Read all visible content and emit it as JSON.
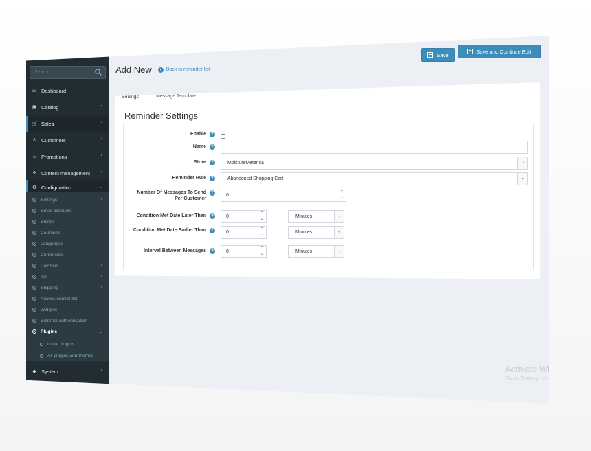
{
  "sidebar": {
    "search_placeholder": "Search",
    "items": [
      {
        "label": "Dashboard",
        "icon": "monitor-icon",
        "has_chevron": false
      },
      {
        "label": "Catalog",
        "icon": "book-icon",
        "has_chevron": true
      },
      {
        "label": "Sales",
        "icon": "cart-icon",
        "has_chevron": true
      },
      {
        "label": "Customers",
        "icon": "user-icon",
        "has_chevron": true
      },
      {
        "label": "Promotions",
        "icon": "tag-icon",
        "has_chevron": true
      },
      {
        "label": "Content management",
        "icon": "sitemap-icon",
        "has_chevron": true
      },
      {
        "label": "Configuration",
        "icon": "gears-icon",
        "has_chevron": true
      }
    ],
    "submenu": [
      {
        "label": "Settings",
        "has_chevron": true
      },
      {
        "label": "Email accounts",
        "has_chevron": false
      },
      {
        "label": "Stores",
        "has_chevron": false
      },
      {
        "label": "Countries",
        "has_chevron": false
      },
      {
        "label": "Languages",
        "has_chevron": false
      },
      {
        "label": "Currencies",
        "has_chevron": false
      },
      {
        "label": "Payment",
        "has_chevron": true
      },
      {
        "label": "Tax",
        "has_chevron": true
      },
      {
        "label": "Shipping",
        "has_chevron": true
      },
      {
        "label": "Access control list",
        "has_chevron": false
      },
      {
        "label": "Widgets",
        "has_chevron": false
      },
      {
        "label": "External authentication",
        "has_chevron": false
      },
      {
        "label": "Plugins",
        "has_chevron": true
      },
      {
        "label": "Local plugins",
        "has_chevron": false
      },
      {
        "label": "All plugins and themes",
        "has_chevron": false
      }
    ],
    "system": {
      "label": "System",
      "icon": "cube-icon",
      "has_chevron": true
    }
  },
  "header": {
    "title": "Add New",
    "back_link": "Back to reminder list",
    "save_label": "Save",
    "save_continue_label": "Save and Continue Edit"
  },
  "tabs": [
    {
      "label": "Settings",
      "active": true
    },
    {
      "label": "Message Template",
      "active": false
    }
  ],
  "section_title": "Reminder Settings",
  "form": {
    "enable_label": "Enable",
    "name_label": "Name",
    "name_value": "",
    "store_label": "Store",
    "store_value": "MoistureMeter.ca",
    "rule_label": "Reminder Rule",
    "rule_value": "Abandoned Shopping Cart",
    "messages_label": "Number Of Messages To Send Per Customer",
    "messages_value": "0",
    "later_label": "Condition Met Date Later Than",
    "later_value": "0",
    "later_unit": "Minutes",
    "earlier_label": "Condition Met Date Earlier Than",
    "earlier_value": "0",
    "earlier_unit": "Minutes",
    "interval_label": "Interval Between Messages",
    "interval_value": "0",
    "interval_unit": "Minutes"
  },
  "watermark": {
    "title": "Activate Windows",
    "subtitle": "Go to Settings to activate Windows."
  },
  "colors": {
    "sidebar": "#222d32",
    "submenu": "#2c3b41",
    "accent": "#3c8dbc",
    "page_bg": "#ecf0f5"
  }
}
